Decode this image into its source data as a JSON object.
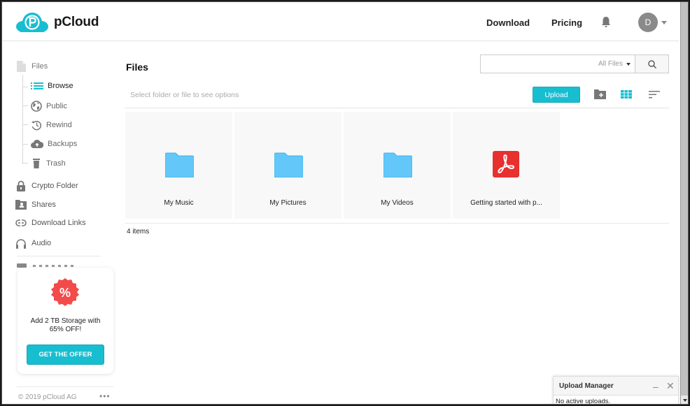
{
  "header": {
    "brand": "pCloud",
    "nav": [
      {
        "label": "Download"
      },
      {
        "label": "Pricing"
      }
    ],
    "avatar_initial": "D"
  },
  "sidebar": {
    "files_label": "Files",
    "sub_items": [
      {
        "label": "Browse",
        "icon": "list-icon",
        "active": true
      },
      {
        "label": "Public",
        "icon": "globe-icon"
      },
      {
        "label": "Rewind",
        "icon": "history-icon"
      },
      {
        "label": "Backups",
        "icon": "cloud-upload-icon"
      },
      {
        "label": "Trash",
        "icon": "trash-icon"
      }
    ],
    "items": [
      {
        "label": "Crypto Folder",
        "icon": "lock-icon"
      },
      {
        "label": "Shares",
        "icon": "shared-folder-icon"
      },
      {
        "label": "Download Links",
        "icon": "link-icon"
      },
      {
        "label": "Audio",
        "icon": "headphones-icon"
      }
    ],
    "promo": {
      "badge": "%",
      "text": "Add 2 TB Storage with 65% OFF!",
      "button": "GET THE OFFER"
    },
    "copyright": "© 2019 pCloud AG",
    "more": "•••"
  },
  "main": {
    "title": "Files",
    "search": {
      "placeholder": "",
      "filter": "All Files"
    },
    "hint": "Select folder or file to see options",
    "upload_label": "Upload",
    "items": [
      {
        "name": "My Music",
        "type": "folder"
      },
      {
        "name": "My Pictures",
        "type": "folder"
      },
      {
        "name": "My Videos",
        "type": "folder"
      },
      {
        "name": "Getting started with p...",
        "type": "pdf"
      }
    ],
    "count": "4 items"
  },
  "upload_manager": {
    "title": "Upload Manager",
    "status": "No active uploads."
  },
  "colors": {
    "accent": "#17bed0",
    "folder": "#63c7f9",
    "pdf": "#e8302f",
    "promo_badge": "#f34a4a"
  }
}
